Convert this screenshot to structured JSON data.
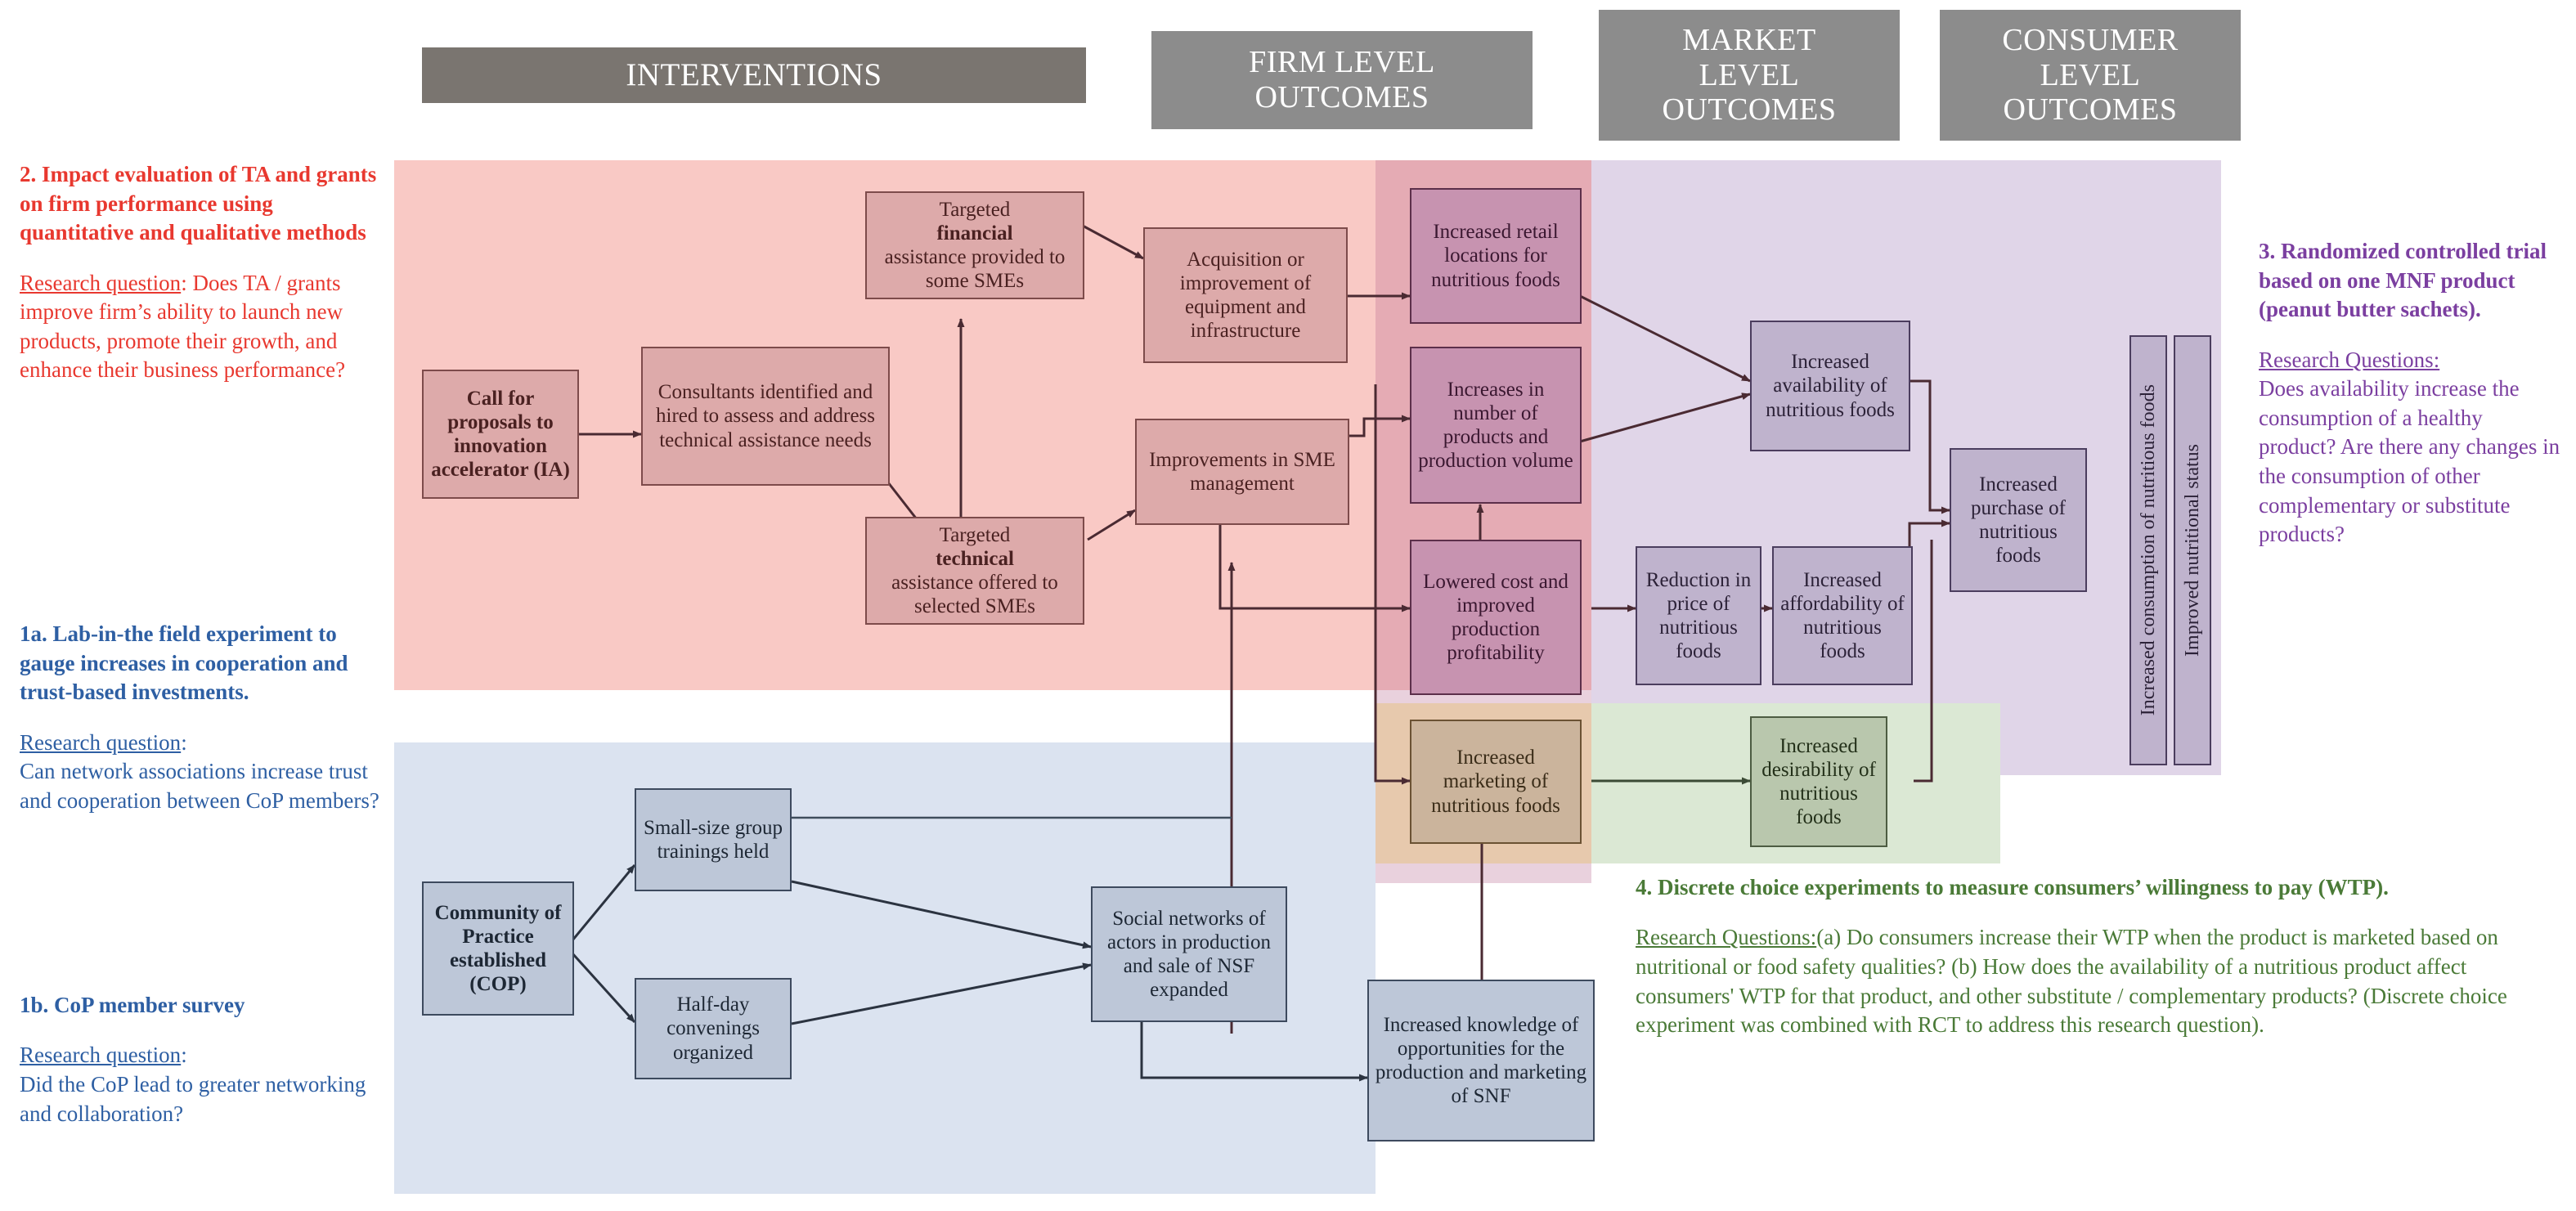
{
  "headers": [
    {
      "label": "INTERVENTIONS"
    },
    {
      "label": "FIRM LEVEL\nOUTCOMES"
    },
    {
      "label": "MARKET\nLEVEL\nOUTCOMES"
    },
    {
      "label": "CONSUMER\nLEVEL\nOUTCOMES"
    }
  ],
  "nodes": {
    "call_for_proposals": "Call for proposals to innovation accelerator (IA)",
    "consultants": "Consultants identified and hired to assess and address technical assistance needs",
    "targeted_financial_pre": "Targeted ",
    "targeted_financial_bold": "financial",
    "targeted_financial_post": " assistance provided to some SMEs",
    "targeted_technical_pre": "Targeted ",
    "targeted_technical_bold": "technical",
    "targeted_technical_post": " assistance offered to selected SMEs",
    "acquisition": "Acquisition or improvement of equipment and infrastructure",
    "improvements_sme": "Improvements in SME management",
    "increased_retail": "Increased retail locations for nutritious foods",
    "increases_products": "Increases in number of products and production volume",
    "lowered_cost": "Lowered cost and improved production profitability",
    "increased_marketing": "Increased marketing of nutritious foods",
    "reduction_price": "Reduction in price of nutritious foods",
    "increased_availability": "Increased availability  of nutritious foods",
    "increased_affordability": "Increased affordability of nutritious foods",
    "increased_desirability": "Increased desirability of nutritious foods",
    "increased_purchase": "Increased purchase of nutritious foods",
    "increased_consumption": "Increased consumption of nutritious foods",
    "improved_nutritional_status": "Improved nutritional status",
    "cop_established": "Community of Practice established (COP)",
    "small_group_trainings": "Small-size group trainings held",
    "half_day_convenings": "Half-day convenings organized",
    "social_networks": "Social networks of actors in production and sale of NSF expanded",
    "increased_knowledge": "Increased knowledge of opportunities for the production and marketing of SNF"
  },
  "annotations": {
    "item2": {
      "color": "#e8382f",
      "heading": "2. Impact evaluation of TA and grants on firm performance using quantitative and qualitative methods",
      "rq_label": "Research question",
      "rq_body": ": Does TA / grants improve firm’s ability to launch new products, promote their growth, and enhance their business performance?"
    },
    "item1a": {
      "color": "#2e5fa3",
      "heading": "1a. Lab-in-the field experiment to gauge increases in cooperation and trust-based investments.",
      "rq_label": "Research question",
      "rq_body": ":\nCan network associations increase trust and cooperation between CoP members?"
    },
    "item1b": {
      "color": "#2e5fa3",
      "heading": "1b. CoP member survey",
      "rq_label": "Research question",
      "rq_body": ":\nDid the CoP lead to greater networking and collaboration?"
    },
    "item3": {
      "color": "#7b3fa0",
      "heading": "3. Randomized controlled trial based on one MNF product (peanut butter sachets).",
      "rq_label": "Research Questions:",
      "rq_body": "Does availability increase the consumption of a healthy product? Are there any changes in the consumption of other complementary or substitute products?"
    },
    "item4": {
      "color": "#4a7a37",
      "heading": "4. Discrete choice experiments to measure consumers’ willingness to pay (WTP).",
      "rq_label": "Research Questions:",
      "rq_body": "(a) Do consumers increase their WTP when the product is marketed based on nutritional or food safety qualities? (b) How does the availability of a nutritious product affect consumers' WTP for that product, and other substitute / complementary products? (Discrete choice experiment was combined with RCT to address this research question)."
    }
  },
  "colors": {
    "banner": "#7a7570",
    "band_interventions": "#f9c9c5",
    "band_firm": "#c7879f",
    "band_market": "#e0d5e8",
    "band_consumer": "#e0d5e8",
    "band_cop": "#dbe3f0",
    "band_marketing": "#e7c9ad",
    "band_desirability": "#dbe8d4",
    "node_pink": "#ddaaaa",
    "node_firm": "#c793b0",
    "node_purple": "#bfb3cd",
    "node_blue": "#bdc7d8",
    "node_orange": "#cbb49c",
    "node_green": "#b9c7ad",
    "text_red": "#e8382f",
    "text_blue": "#2e5fa3",
    "text_violet": "#7b3fa0",
    "text_green": "#4a7a37"
  }
}
